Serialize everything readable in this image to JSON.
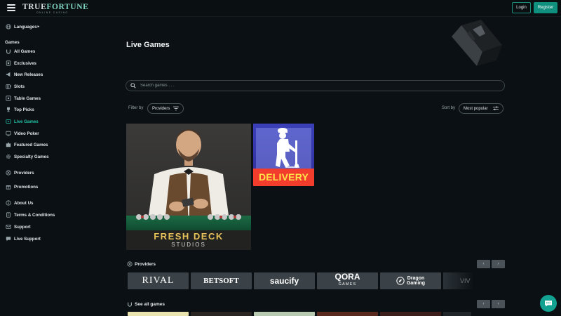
{
  "header": {
    "brand_part1": "TRUE",
    "brand_part2": "FORTUNE",
    "tagline": "ONLINE CASINO",
    "login_label": "Login",
    "register_label": "Register"
  },
  "sidebar": {
    "languages_label": "Languages",
    "games_heading": "Games",
    "items": [
      {
        "label": "All Games",
        "icon": "horseshoe-icon"
      },
      {
        "label": "Exclusives",
        "icon": "card-icon"
      },
      {
        "label": "New Releases",
        "icon": "megaphone-icon"
      },
      {
        "label": "Slots",
        "icon": "slot-icon"
      },
      {
        "label": "Table Games",
        "icon": "table-icon"
      },
      {
        "label": "Top Picks",
        "icon": "trophy-icon"
      },
      {
        "label": "Live Games",
        "icon": "live-icon"
      },
      {
        "label": "Video Poker",
        "icon": "video-poker-icon"
      },
      {
        "label": "Featured Games",
        "icon": "puzzle-icon"
      },
      {
        "label": "Specialty Games",
        "icon": "gear-icon"
      }
    ],
    "providers_label": "Providers",
    "promotions_label": "Promotions",
    "about_label": "About Us",
    "terms_label": "Terms & Conditions",
    "support_label": "Support",
    "live_support_label": "Live Support"
  },
  "main": {
    "title": "Live Games",
    "search_placeholder": "Search games . . .",
    "filter_label": "Filter by",
    "filter_value": "Providers",
    "sort_label": "Sort by",
    "sort_value": "Most popular",
    "games": [
      {
        "title_line1": "FRESH DECK",
        "title_line2": "STUDIOS"
      },
      {
        "title": "DELIVERY"
      }
    ],
    "providers_section": "Providers",
    "providers": [
      "RIVAL",
      "BETSOFT",
      "saucify",
      "QORA",
      "GAMES",
      "Dragon",
      "Gaming",
      "VIV"
    ],
    "see_all_label": "See all games",
    "prev_arrow": "‹",
    "next_arrow": "›"
  },
  "colors": {
    "accent": "#25c2a7",
    "register_bg": "#0f8f7e",
    "background": "#0b1014"
  }
}
